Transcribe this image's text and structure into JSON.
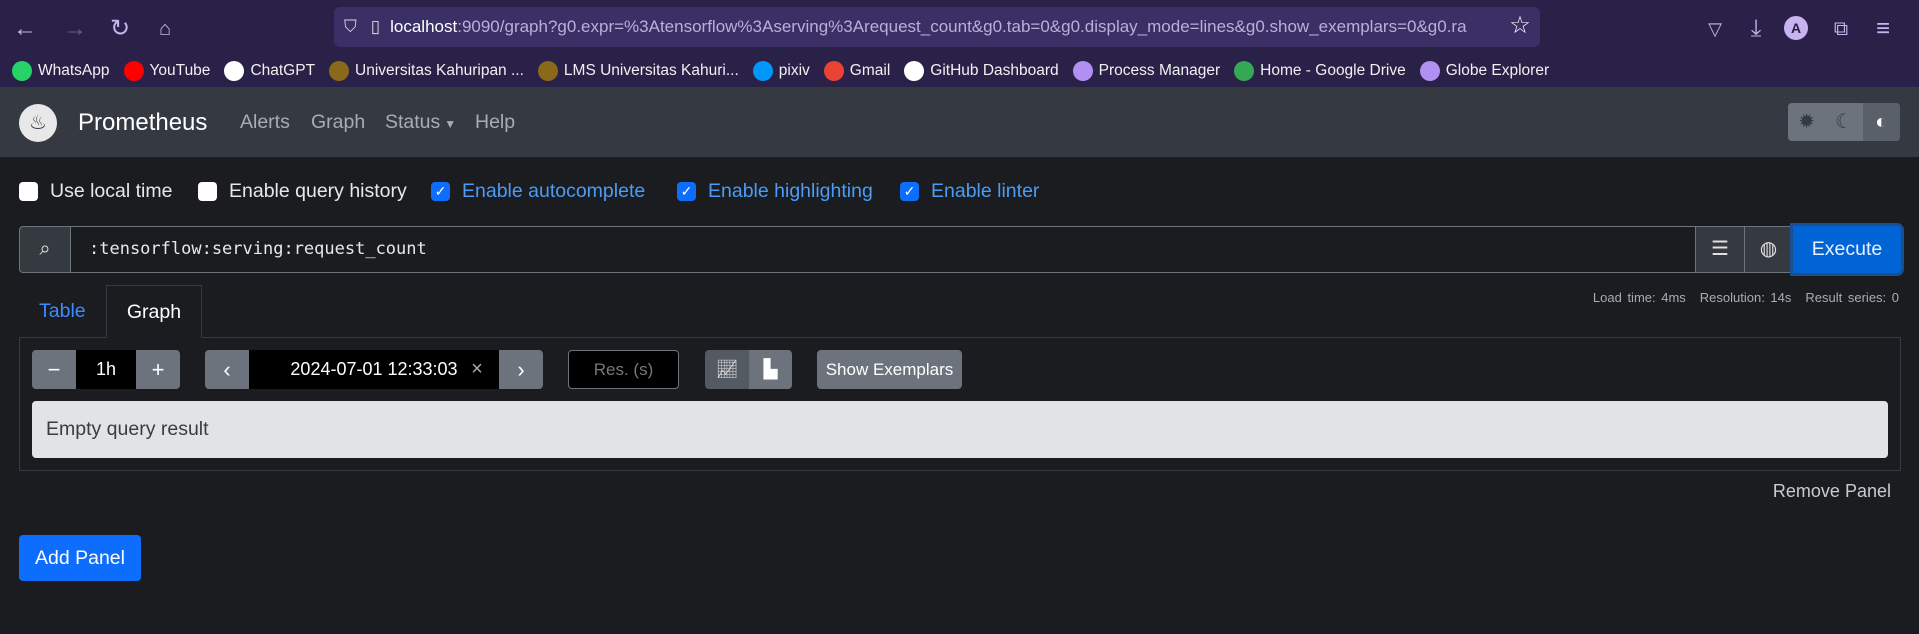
{
  "browser": {
    "url_host": "localhost",
    "url_rest": ":9090/graph?g0.expr=%3Atensorflow%3Aserving%3Arequest_count&g0.tab=0&g0.display_mode=lines&g0.show_exemplars=0&g0.ra",
    "bookmarks": [
      {
        "label": "WhatsApp",
        "color": "#25d366",
        "icon": "whatsapp-icon"
      },
      {
        "label": "YouTube",
        "color": "#ff0000",
        "icon": "youtube-icon"
      },
      {
        "label": "ChatGPT",
        "color": "#ffffff",
        "icon": "chatgpt-icon"
      },
      {
        "label": "Universitas Kahuripan ...",
        "color": "#8a6a1a",
        "icon": "university-icon"
      },
      {
        "label": "LMS Universitas Kahuri...",
        "color": "#8a6a1a",
        "icon": "university-icon"
      },
      {
        "label": "pixiv",
        "color": "#0096fa",
        "icon": "pixiv-icon"
      },
      {
        "label": "Gmail",
        "color": "#ea4335",
        "icon": "gmail-icon"
      },
      {
        "label": "GitHub Dashboard",
        "color": "#ffffff",
        "icon": "github-icon"
      },
      {
        "label": "Process Manager",
        "color": "#b090f0",
        "icon": "gauge-icon"
      },
      {
        "label": "Home - Google Drive",
        "color": "#34a853",
        "icon": "drive-icon"
      },
      {
        "label": "Globe Explorer",
        "color": "#b090f0",
        "icon": "globe-icon"
      }
    ],
    "avatar": "A"
  },
  "nav": {
    "brand": "Prometheus",
    "links": [
      "Alerts",
      "Graph",
      "Status",
      "Help"
    ]
  },
  "options": [
    {
      "label": "Use local time",
      "checked": false
    },
    {
      "label": "Enable query history",
      "checked": false
    },
    {
      "label": "Enable autocomplete",
      "checked": true
    },
    {
      "label": "Enable highlighting",
      "checked": true
    },
    {
      "label": "Enable linter",
      "checked": true
    }
  ],
  "query": {
    "expr": ":tensorflow:serving:request_count",
    "execute": "Execute"
  },
  "stats": {
    "load": "Load time: 4ms",
    "resolution": "Resolution: 14s",
    "series": "Result series: 0"
  },
  "tabs": {
    "table": "Table",
    "graph": "Graph"
  },
  "controls": {
    "minus": "−",
    "range": "1h",
    "plus": "+",
    "end_time": "2024-07-01 12:33:03",
    "clear": "×",
    "res_placeholder": "Res. (s)",
    "exemplars": "Show Exemplars"
  },
  "result": "Empty query result",
  "remove_panel": "Remove Panel",
  "add_panel": "Add Panel"
}
